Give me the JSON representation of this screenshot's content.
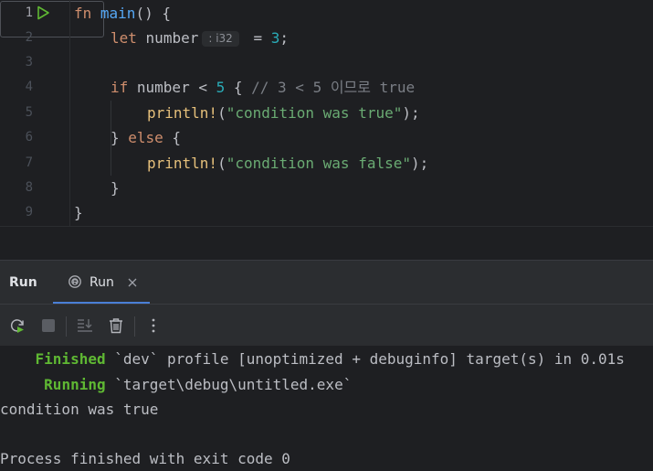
{
  "editor": {
    "line_numbers": [
      "1",
      "2",
      "3",
      "4",
      "5",
      "6",
      "7",
      "8",
      "9"
    ],
    "lines": {
      "l1": {
        "fn": "fn",
        "name": "main",
        "rest": "() {"
      },
      "l2": {
        "let": "let",
        "var": "number",
        "hint": ": i32",
        "eq": " = ",
        "num": "3",
        "semi": ";"
      },
      "l4": {
        "if": "if",
        "cond_a": " number < ",
        "five": "5",
        "brace": " { ",
        "comment": "// 3 < 5 이므로 true"
      },
      "l5": {
        "macro": "println!",
        "open": "(",
        "str": "\"condition was true\"",
        "close": ");"
      },
      "l6": {
        "close": "} ",
        "else": "else",
        "open": " {"
      },
      "l7": {
        "macro": "println!",
        "open": "(",
        "str": "\"condition was false\"",
        "close": ");"
      },
      "l8": {
        "text": "}"
      },
      "l9": {
        "text": "}"
      }
    }
  },
  "toolwindow": {
    "title": "Run",
    "tab_label": "Run"
  },
  "toolbar": {
    "icons": [
      "rerun-icon",
      "stop-icon",
      "scroll-to-end-icon",
      "clear-icon",
      "more-options-icon"
    ]
  },
  "console": {
    "finished_word": "Finished",
    "finished_rest": " `dev` profile [unoptimized + debuginfo] target(s) in 0.01s",
    "running_word": "Running",
    "running_rest": " `target\\debug\\untitled.exe`",
    "output": "condition was true",
    "exit": "Process finished with exit code 0"
  },
  "colors": {
    "background": "#1e1f22",
    "panel": "#2b2d30",
    "keyword": "#cf8e6d",
    "function": "#56a8f5",
    "number": "#2aacb8",
    "string": "#6aab73",
    "macro": "#e6c07b",
    "comment": "#7a7e85",
    "run_green": "#5fb833",
    "tab_underline": "#4a7fd6"
  }
}
